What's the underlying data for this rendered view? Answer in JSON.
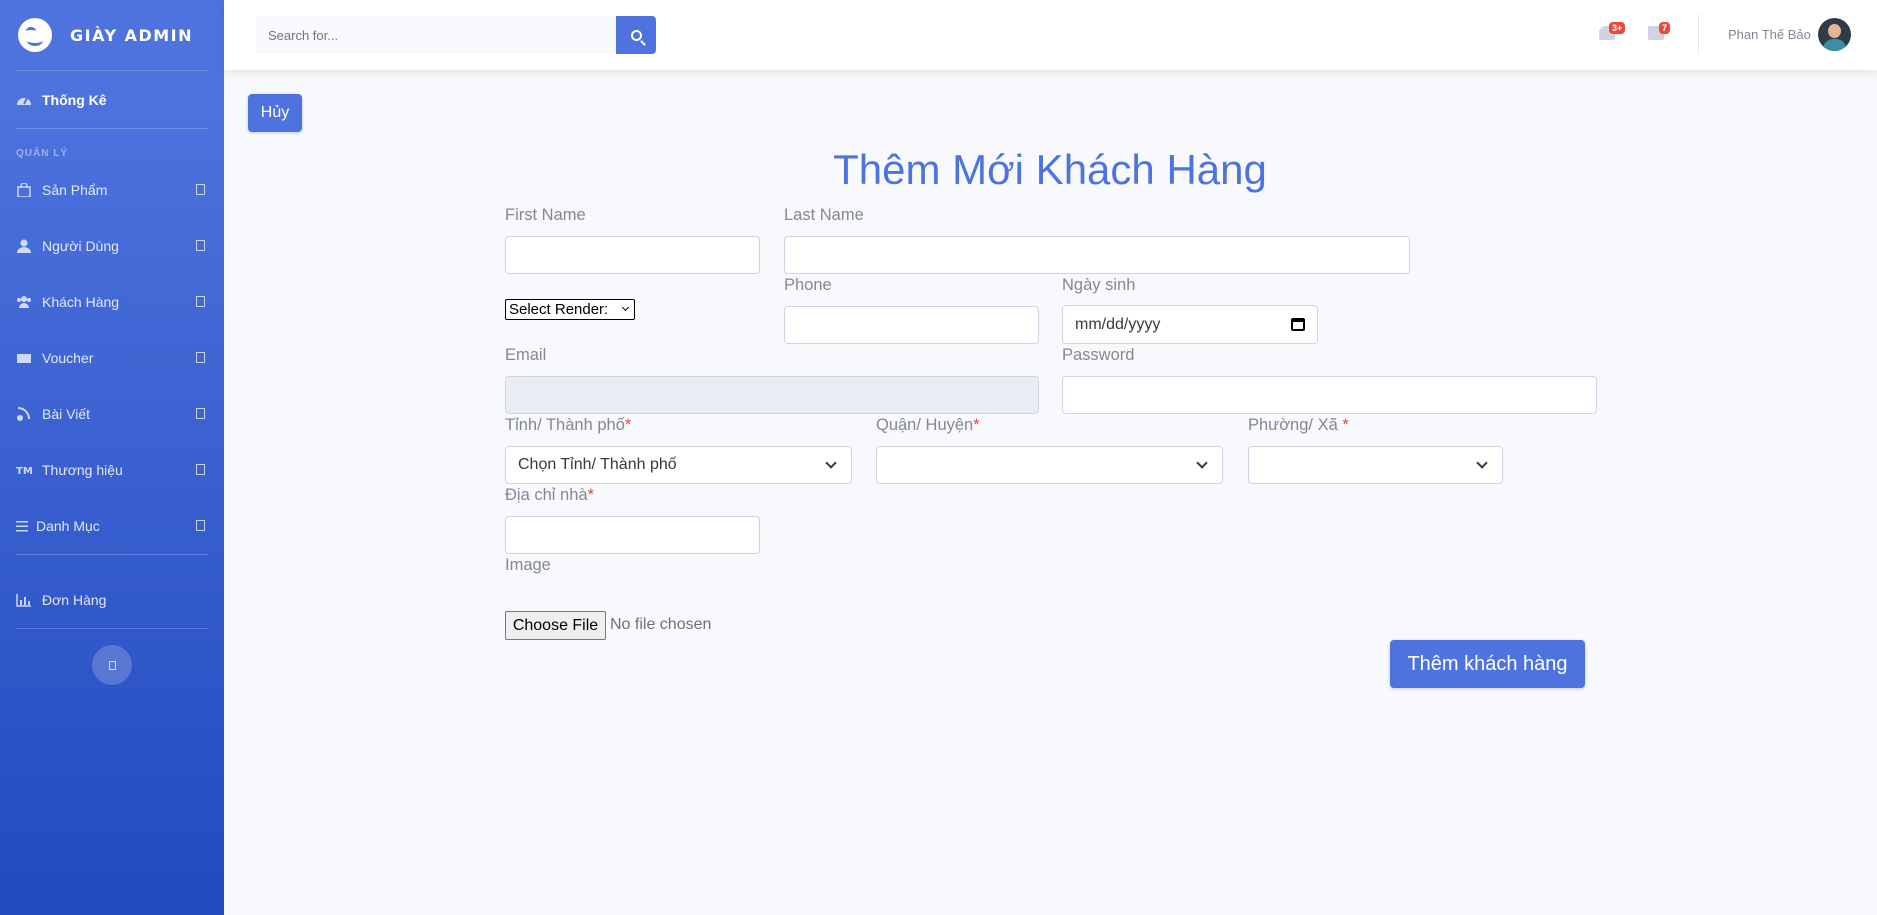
{
  "brand": {
    "name": "GIÀY ADMIN",
    "logo_icon": "laugh-wink-icon"
  },
  "sidebar": {
    "dashboard": {
      "label": "Thống Kê",
      "icon": "tachometer-icon"
    },
    "heading": "QUẢN LÝ",
    "items": [
      {
        "label": "Sản Phẩm",
        "icon": "shopping-bag-icon"
      },
      {
        "label": "Người Dùng",
        "icon": "user-icon"
      },
      {
        "label": "Khách Hàng",
        "icon": "users-icon"
      },
      {
        "label": "Voucher",
        "icon": "ticket-icon"
      },
      {
        "label": "Bài Viết",
        "icon": "blog-icon"
      },
      {
        "label": "Thương hiệu",
        "icon": "trademark-icon"
      },
      {
        "label": "Danh Mục",
        "icon": "list-icon"
      }
    ],
    "orders": {
      "label": "Đơn Hàng",
      "icon": "chart-bar-icon"
    }
  },
  "topbar": {
    "search_placeholder": "Search for...",
    "alerts_count": "3+",
    "messages_count": "7",
    "user_name": "Phan Thế Bảo"
  },
  "page": {
    "cancel_label": "Hủy",
    "title": "Thêm Mới Khách Hàng",
    "submit_label": "Thêm khách hàng"
  },
  "form": {
    "first_name": {
      "label": "First Name",
      "value": ""
    },
    "last_name": {
      "label": "Last Name",
      "value": ""
    },
    "gender_select": "Select Render:",
    "phone": {
      "label": "Phone",
      "value": ""
    },
    "birthday": {
      "label": "Ngày sinh",
      "placeholder": "mm/dd/yyyy"
    },
    "email": {
      "label": "Email",
      "value": ""
    },
    "password": {
      "label": "Password",
      "value": ""
    },
    "province": {
      "label": "Tỉnh/ Thành phố",
      "selected": "Chọn Tỉnh/ Thành phố"
    },
    "district": {
      "label": "Quận/ Huyện",
      "selected": ""
    },
    "ward": {
      "label": "Phường/ Xã ",
      "selected": ""
    },
    "address": {
      "label": "Địa chỉ nhà",
      "value": ""
    },
    "image": {
      "label": "Image",
      "button": "Choose File",
      "status": "No file chosen"
    }
  },
  "colors": {
    "primary": "#4e73df",
    "danger": "#e74a3b",
    "text_muted": "#858796"
  }
}
